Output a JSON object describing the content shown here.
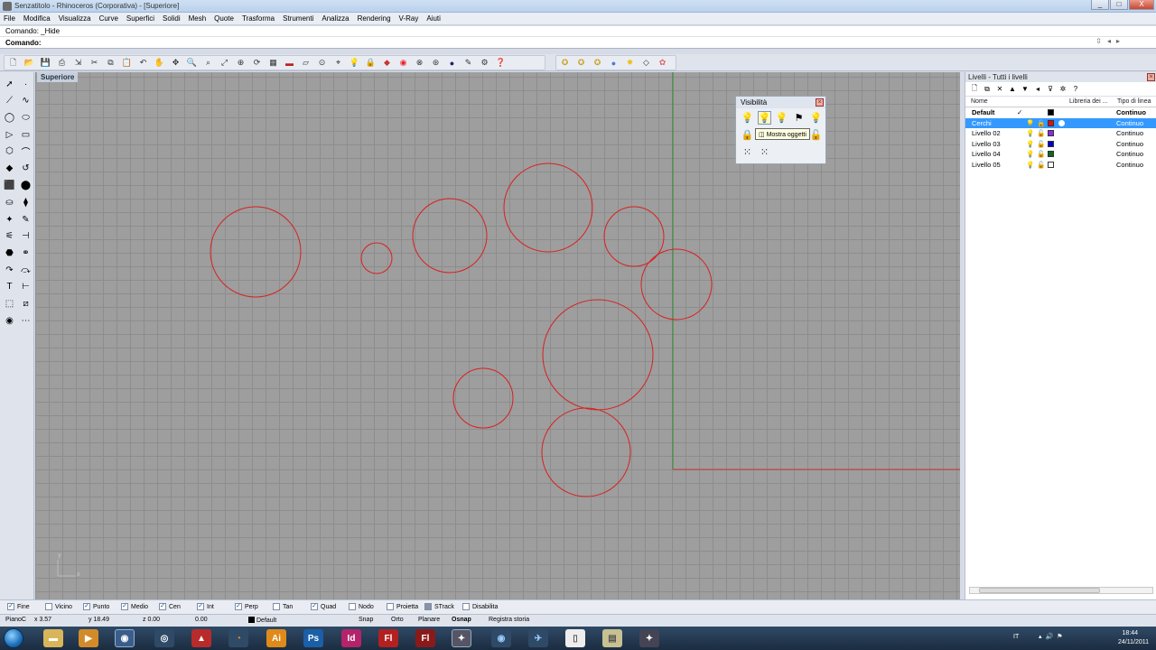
{
  "window": {
    "title": "Senzatitolo - Rhinoceros (Corporativa) - [Superiore]",
    "controls": [
      "_",
      "□",
      "X"
    ]
  },
  "menu": [
    "File",
    "Modifica",
    "Visualizza",
    "Curve",
    "Superfici",
    "Solidi",
    "Mesh",
    "Quote",
    "Trasforma",
    "Strumenti",
    "Analizza",
    "Rendering",
    "V-Ray",
    "Aiuti"
  ],
  "command": {
    "history": "Comando: _Hide",
    "prompt": "Comando:"
  },
  "viewport": {
    "label": "Superiore",
    "axis_y": "y",
    "axis_x": "x",
    "circle_color": "#d92020"
  },
  "visibility_panel": {
    "title": "Visibilità",
    "tooltip": "Mostra oggetti"
  },
  "layers_panel": {
    "title": "Livelli - Tutti i livelli",
    "columns": {
      "name": "Nome",
      "library": "Libreria dei ...",
      "linetype": "Tipo di linea"
    },
    "rows": [
      {
        "name": "Default",
        "current": "✓",
        "color": "#000000",
        "linetype": "Continuo",
        "selected": false
      },
      {
        "name": "Cerchi",
        "current": "",
        "color": "#e01010",
        "linetype": "Continuo",
        "selected": true
      },
      {
        "name": "Livello 02",
        "current": "",
        "color": "#8a2be2",
        "linetype": "Continuo",
        "selected": false
      },
      {
        "name": "Livello 03",
        "current": "",
        "color": "#0000cc",
        "linetype": "Continuo",
        "selected": false
      },
      {
        "name": "Livello 04",
        "current": "",
        "color": "#116622",
        "linetype": "Continuo",
        "selected": false
      },
      {
        "name": "Livello 05",
        "current": "",
        "color": "#ffffff",
        "linetype": "Continuo",
        "selected": false
      }
    ]
  },
  "osnap": [
    {
      "label": "Fine",
      "checked": true
    },
    {
      "label": "Vicino",
      "checked": false
    },
    {
      "label": "Punto",
      "checked": true
    },
    {
      "label": "Medio",
      "checked": true
    },
    {
      "label": "Cen",
      "checked": true
    },
    {
      "label": "Int",
      "checked": true
    },
    {
      "label": "Perp",
      "checked": true
    },
    {
      "label": "Tan",
      "checked": false
    },
    {
      "label": "Quad",
      "checked": true
    },
    {
      "label": "Nodo",
      "checked": false
    },
    {
      "label": "Proietta",
      "checked": false
    },
    {
      "label": "STrack",
      "checked": false
    },
    {
      "label": "Disabilita",
      "checked": false
    }
  ],
  "status": {
    "cplane": "PianoC",
    "x": "x 3.57",
    "y": "y 18.49",
    "z": "z 0.00",
    "dist": "0.00",
    "layer": "Default",
    "toggles": [
      "Snap",
      "Orto",
      "Planare",
      "Osnap",
      "Registra storia"
    ]
  },
  "taskbar": {
    "apps": [
      "Ai",
      "Ps",
      "Id",
      "Fl",
      "Fl"
    ],
    "language": "IT",
    "time": "18:44",
    "date": "24/11/2011"
  }
}
